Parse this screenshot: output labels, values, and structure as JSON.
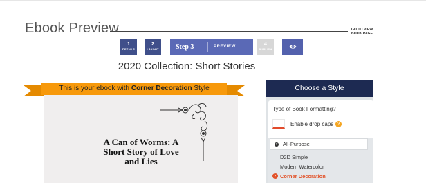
{
  "header": {
    "title": "Ebook Preview",
    "view_link": "GO TO VIEW BOOK PAGE"
  },
  "steps": [
    {
      "number": "1",
      "label": "DETAILS",
      "state": "done"
    },
    {
      "number": "2",
      "label": "LAYOUT",
      "state": "done"
    },
    {
      "number": "Step 3",
      "label": "PREVIEW",
      "state": "current",
      "icon": "eye-icon"
    },
    {
      "number": "4",
      "label": "PUBLISH",
      "state": "disabled"
    }
  ],
  "collection_title": "2020 Collection: Short Stories",
  "banner": {
    "prefix": "This is your ebook with ",
    "style_name": "Corner Decoration",
    "suffix": " Style"
  },
  "book": {
    "title_line1": "A Can of Worms: A",
    "title_line2": "Short Story of Love",
    "title_line3": "and Lies"
  },
  "style_panel": {
    "header": "Choose a Style",
    "formatting_question": "Type of Book Formatting?",
    "drop_caps_label": "Enable drop caps",
    "drop_caps_checked": false,
    "help_icon": "?",
    "group_label": "All-Purpose",
    "styles": [
      {
        "label": "D2D Simple",
        "selected": false
      },
      {
        "label": "Modern Watercolor",
        "selected": false
      },
      {
        "label": "Corner Decoration",
        "selected": true
      }
    ]
  },
  "colors": {
    "step_done": "#3f4f8a",
    "step_current": "#5a69b6",
    "step_disabled": "#d7d7d7",
    "banner": "#f7990b",
    "panel_header": "#1d2a52",
    "accent": "#e2532a"
  }
}
